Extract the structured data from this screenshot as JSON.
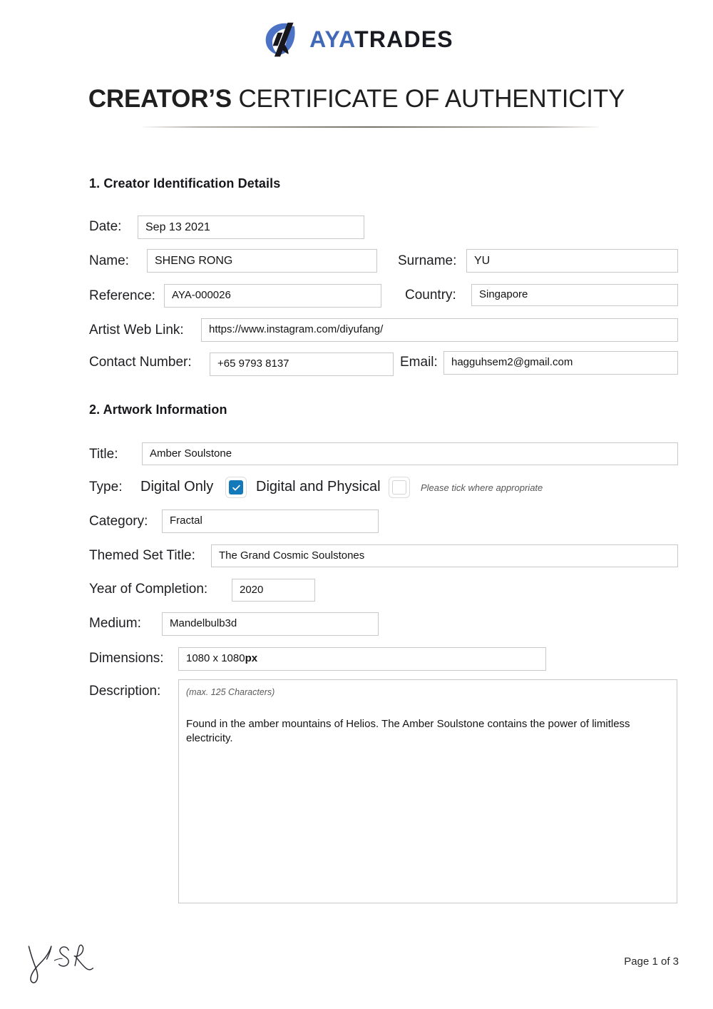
{
  "brand": {
    "name_part1": "AYA",
    "name_part2": "TRADES",
    "logo_icon": "aya-swoosh-logo-icon",
    "accent_blue": "#4169b8",
    "dark": "#1a1a22"
  },
  "document": {
    "title_strong": "CREATOR’S",
    "title_rest": " CERTIFICATE OF AUTHENTICITY"
  },
  "section1": {
    "heading": "1. Creator Identification Details",
    "fields": {
      "date_label": "Date:",
      "date_value": "Sep 13 2021",
      "name_label": "Name:",
      "name_value": "SHENG RONG",
      "surname_label": "Surname:",
      "surname_value": "YU",
      "reference_label": "Reference:",
      "reference_value": "AYA-000026",
      "country_label": "Country:",
      "country_value": "Singapore",
      "weblink_label": "Artist Web Link:",
      "weblink_value": "https://www.instagram.com/diyufang/",
      "contact_label": "Contact Number:",
      "contact_value": "+65 9793 8137",
      "email_label": "Email:",
      "email_value": "hagguhsem2@gmail.com"
    }
  },
  "section2": {
    "heading": "2. Artwork Information",
    "fields": {
      "title_label": "Title:",
      "title_value": "Amber Soulstone",
      "type_label": "Type:",
      "type_option1": "Digital Only",
      "type_option1_checked": true,
      "type_option2": "Digital and Physical",
      "type_option2_checked": false,
      "type_hint": "Please tick where appropriate",
      "category_label": "Category:",
      "category_value": "Fractal",
      "themed_set_label": "Themed Set Title:",
      "themed_set_value": "The Grand Cosmic Soulstones",
      "year_label": "Year of Completion:",
      "year_value": "2020",
      "medium_label": "Medium:",
      "medium_value": "Mandelbulb3d",
      "dimensions_label": "Dimensions:",
      "dimensions_value": "1080 x 1080 ",
      "dimensions_unit": "px",
      "description_label": "Description:",
      "description_hint": "(max. 125 Characters)",
      "description_value": "Found in the amber mountains of Helios. The Amber Soulstone contains the power of limitless electricity."
    }
  },
  "footer": {
    "signature_icon": "handwritten-signature-ysr",
    "signature_text": "YSR",
    "page_indicator": "Page 1 of 3"
  }
}
